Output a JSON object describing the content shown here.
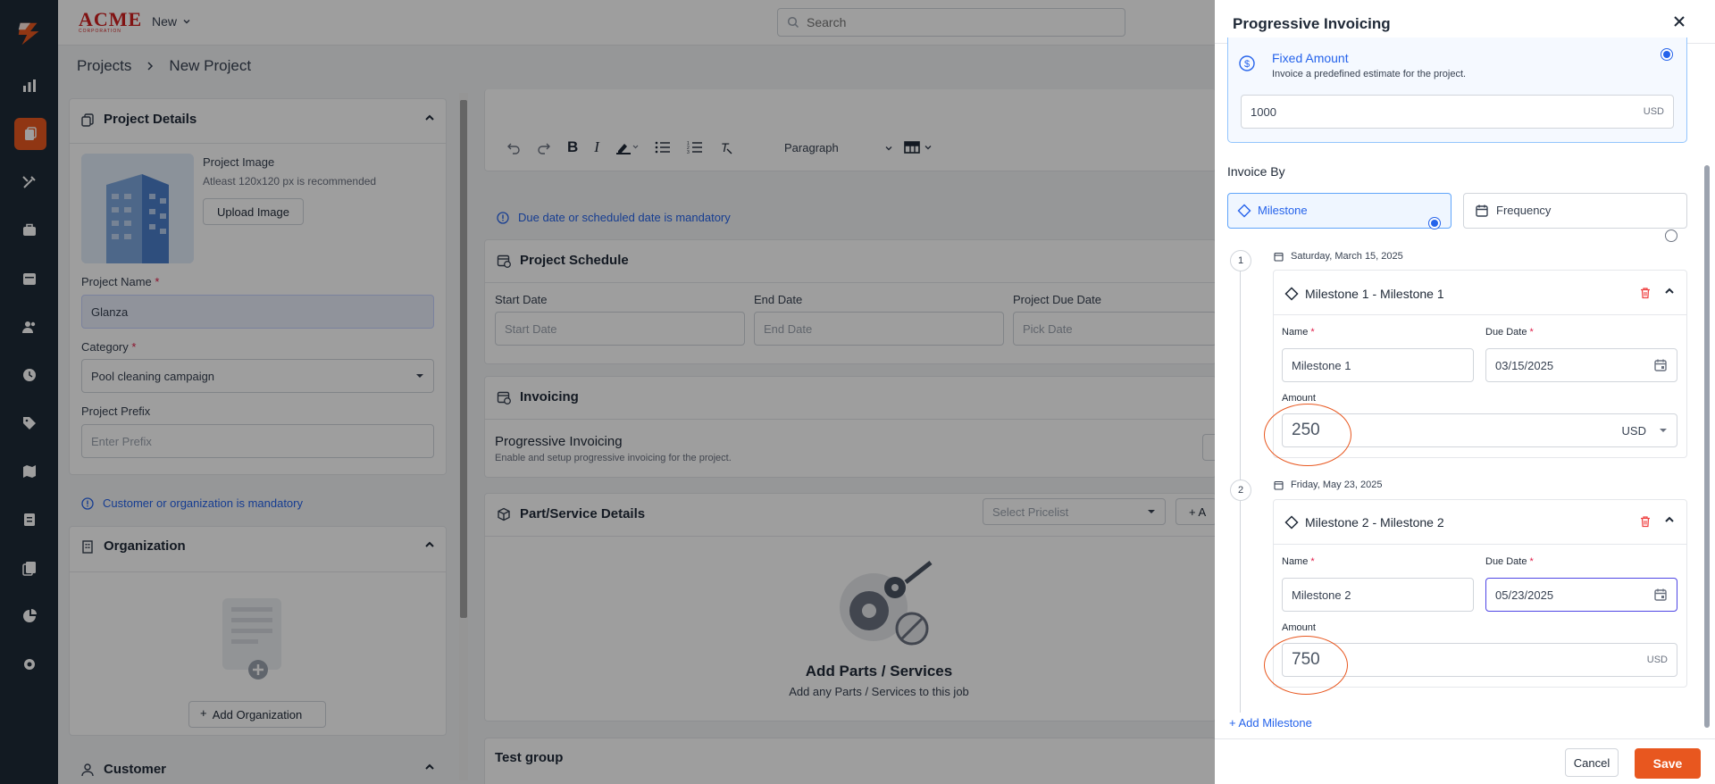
{
  "brand": {
    "logo_text": "ACME",
    "logo_sub": "CORPORATION",
    "accent": "#e8571f"
  },
  "topbar": {
    "new_label": "New",
    "search_placeholder": "Search"
  },
  "breadcrumb": {
    "items": [
      "Projects",
      "New Project"
    ]
  },
  "project_details": {
    "title": "Project Details",
    "image_label": "Project Image",
    "image_hint": "Atleast 120x120 px is recommended",
    "upload_label": "Upload Image",
    "name_label": "Project Name",
    "name_value": "Glanza",
    "category_label": "Category",
    "category_value": "Pool cleaning campaign",
    "prefix_label": "Project Prefix",
    "prefix_placeholder": "Enter Prefix"
  },
  "customer_notice": "Customer or organization is mandatory",
  "organization": {
    "title": "Organization",
    "add_label": "Add Organization"
  },
  "customer": {
    "title": "Customer"
  },
  "editor": {
    "paragraph_label": "Paragraph"
  },
  "due_notice": "Due date or scheduled date is mandatory",
  "schedule": {
    "title": "Project Schedule",
    "start_label": "Start Date",
    "start_placeholder": "Start Date",
    "end_label": "End Date",
    "end_placeholder": "End Date",
    "due_label": "Project Due Date",
    "due_placeholder": "Pick Date"
  },
  "invoicing": {
    "title": "Invoicing",
    "progressive_title": "Progressive Invoicing",
    "progressive_desc": "Enable and setup progressive invoicing for the project."
  },
  "parts": {
    "title": "Part/Service Details",
    "pricelist_placeholder": "Select Pricelist",
    "add_partial": "+ A",
    "empty_title": "Add Parts / Services",
    "empty_desc": "Add any Parts / Services to this job"
  },
  "test_group": {
    "title": "Test group"
  },
  "drawer": {
    "title": "Progressive Invoicing",
    "fixed_title": "Fixed Amount",
    "fixed_desc": "Invoice a predefined estimate for the project.",
    "fixed_value": "1000",
    "currency": "USD",
    "invoice_by_label": "Invoice By",
    "option_milestone": "Milestone",
    "option_frequency": "Frequency",
    "milestones": [
      {
        "step": "1",
        "date_text": "Saturday, March 15, 2025",
        "header": "Milestone 1 - Milestone 1",
        "name_label": "Name",
        "name_value": "Milestone 1",
        "due_label": "Due Date",
        "due_value": "03/15/2025",
        "amount_label": "Amount",
        "amount_value": "250",
        "currency": "USD"
      },
      {
        "step": "2",
        "date_text": "Friday, May 23, 2025",
        "header": "Milestone 2 - Milestone 2",
        "name_label": "Name",
        "name_value": "Milestone 2",
        "due_label": "Due Date",
        "due_value": "05/23/2025",
        "amount_label": "Amount",
        "amount_value": "750",
        "currency": "USD"
      }
    ],
    "add_milestone": "+ Add Milestone",
    "cancel_label": "Cancel",
    "save_label": "Save"
  }
}
